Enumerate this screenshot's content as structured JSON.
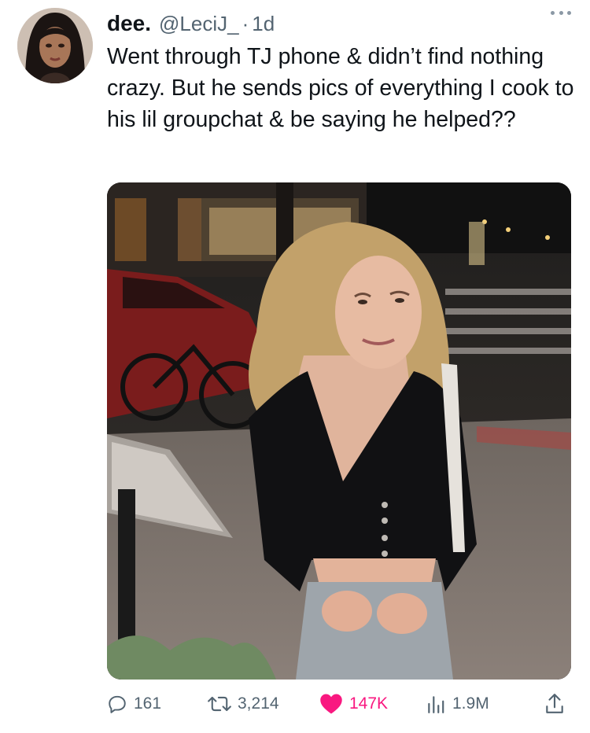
{
  "tweet": {
    "author": {
      "display_name": "dee.",
      "handle": "@LeciJ_",
      "separator": "·",
      "time": "1d"
    },
    "text": "Went through TJ phone & didn’t find nothing crazy. But he sends pics of everything I cook to his lil groupchat & be saying he helped??",
    "more_icon": "more-horizontal-icon"
  },
  "actions": {
    "replies": "161",
    "retweets": "3,214",
    "likes": "147K",
    "views": "1.9M",
    "like_color": "#f91880",
    "icons": [
      "reply-icon",
      "retweet-icon",
      "heart-icon",
      "views-icon",
      "share-icon"
    ]
  }
}
